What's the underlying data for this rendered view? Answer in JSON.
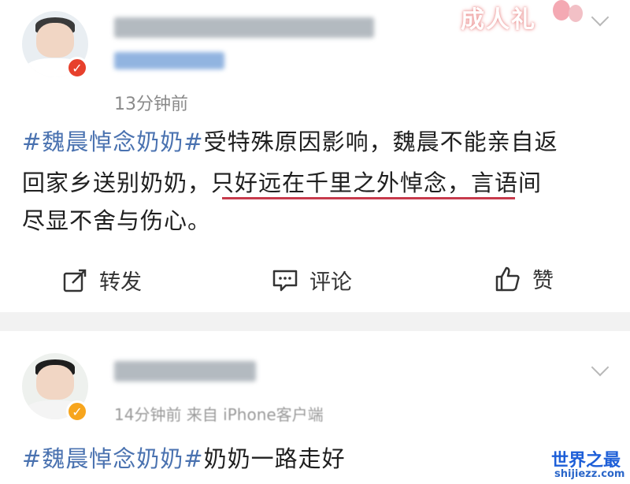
{
  "post1": {
    "time": "13分钟前",
    "badge": "成人礼",
    "tag": "#魏晨悼念奶奶#",
    "line1_rest": "受特殊原因影响，魏晨不能亲自返",
    "line2_a": "回家乡送别奶奶，",
    "line2_highlight": "只好远在千里之外悼念，",
    "line2_b": "言语间",
    "line3": "尽显不舍与伤心。"
  },
  "actions": {
    "repost": "转发",
    "comment": "评论",
    "like": "赞"
  },
  "post2": {
    "meta": "14分钟前 来自 iPhone客户端",
    "tag": "#魏晨悼念奶奶#",
    "rest": "奶奶一路走好"
  },
  "watermark": {
    "title": "世界之最",
    "url": "shijiezz.com"
  },
  "colors": {
    "topic_blue": "#4a72b0",
    "underline_red": "#c73a4c",
    "verify_orange": "#f7a51d"
  }
}
